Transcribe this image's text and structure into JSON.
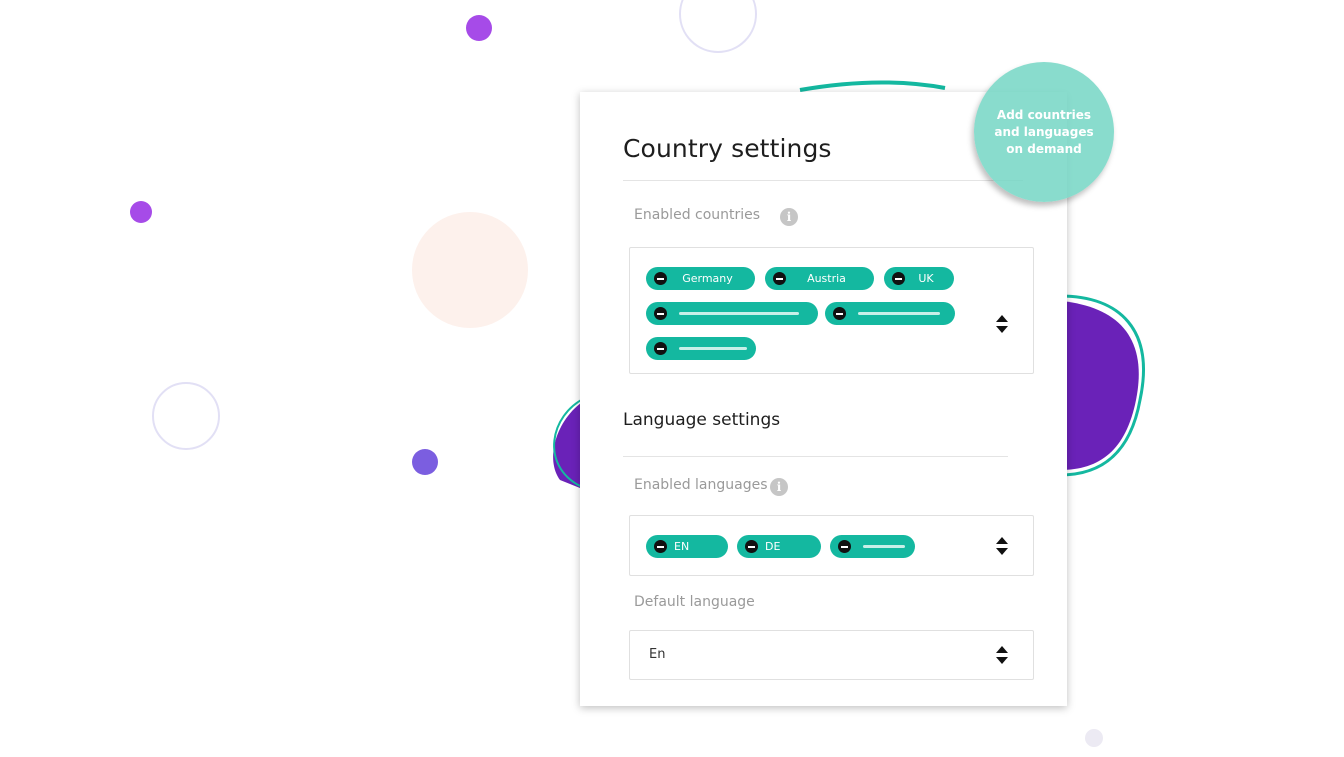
{
  "card": {
    "title": "Country settings",
    "countries_label": "Enabled countries",
    "country_chips": [
      "Germany",
      "Austria",
      "UK"
    ],
    "language_heading": "Language settings",
    "languages_label": "Enabled languages",
    "language_chips": [
      "EN",
      "DE"
    ],
    "default_language_label": "Default language",
    "default_language_value": "En"
  },
  "callout": {
    "text": "Add countries and languages on demand"
  },
  "icons": {
    "info": "info-icon",
    "remove": "minus-circle-icon",
    "sort": "sort-arrows-icon"
  },
  "colors": {
    "teal": "#14b8a0",
    "purple": "#6a22b8",
    "callout": "#74d6c4"
  }
}
